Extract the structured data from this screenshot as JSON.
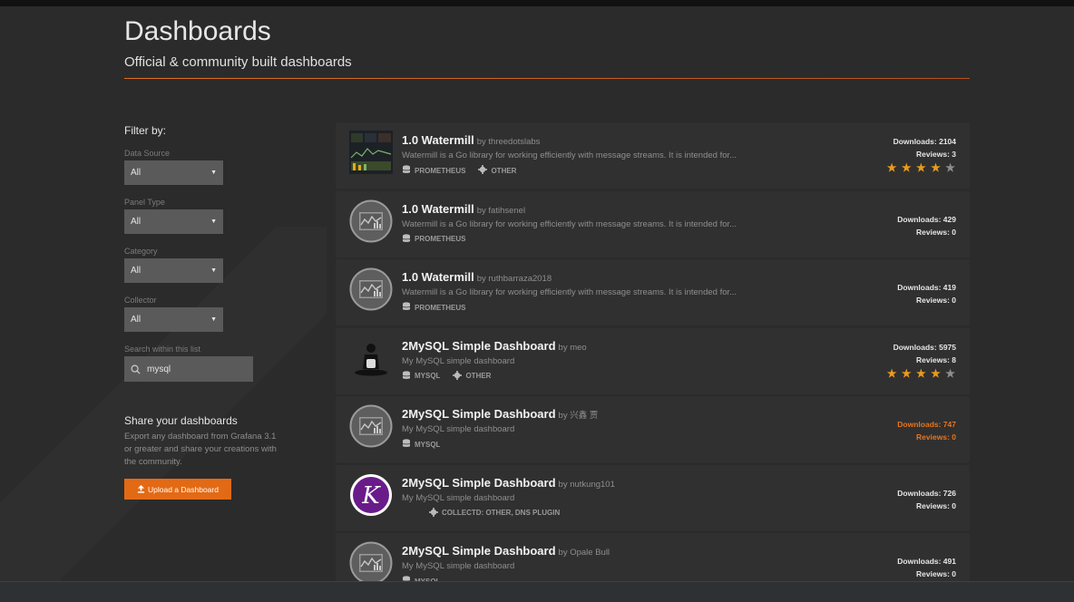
{
  "header": {
    "title": "Dashboards",
    "subtitle": "Official & community built dashboards"
  },
  "sidebar": {
    "filter_title": "Filter by:",
    "filters": [
      {
        "label": "Data Source",
        "value": "All"
      },
      {
        "label": "Panel Type",
        "value": "All"
      },
      {
        "label": "Category",
        "value": "All"
      },
      {
        "label": "Collector",
        "value": "All"
      }
    ],
    "search": {
      "label": "Search within this list",
      "value": "mysql"
    },
    "share": {
      "title": "Share your dashboards",
      "text": "Export any dashboard from Grafana 3.1 or greater and share your creations with the community.",
      "button_label": "Upload a Dashboard"
    }
  },
  "dashboards": [
    {
      "title": "1.0 Watermill",
      "author": "by threedotslabs",
      "description": "Watermill is a Go library for working efficiently with message streams. It is intended for...",
      "tags": [
        {
          "icon": "database-icon",
          "label": "PROMETHEUS"
        },
        {
          "icon": "gear-icon",
          "label": "OTHER"
        }
      ],
      "downloads": "Downloads: 2104",
      "reviews": "Reviews: 3",
      "rating": 4,
      "thumb": "screenshot"
    },
    {
      "title": "1.0 Watermill",
      "author": "by fatihsenel",
      "description": "Watermill is a Go library for working efficiently with message streams. It is intended for...",
      "tags": [
        {
          "icon": "database-icon",
          "label": "PROMETHEUS"
        }
      ],
      "downloads": "Downloads: 429",
      "reviews": "Reviews: 0",
      "rating": null,
      "thumb": "grafana"
    },
    {
      "title": "1.0 Watermill",
      "author": "by ruthbarraza2018",
      "description": "Watermill is a Go library for working efficiently with message streams. It is intended for...",
      "tags": [
        {
          "icon": "database-icon",
          "label": "PROMETHEUS"
        }
      ],
      "downloads": "Downloads: 419",
      "reviews": "Reviews: 0",
      "rating": null,
      "thumb": "grafana"
    },
    {
      "title": "2MySQL Simple Dashboard",
      "author": "by meo",
      "description": "My MySQL simple dashboard",
      "tags": [
        {
          "icon": "database-icon",
          "label": "MYSQL"
        },
        {
          "icon": "gear-icon",
          "label": "OTHER"
        }
      ],
      "downloads": "Downloads: 5975",
      "reviews": "Reviews: 8",
      "rating": 4,
      "thumb": "silhouette"
    },
    {
      "title": "2MySQL Simple Dashboard",
      "author": "by 兴鑫 贾",
      "description": "My MySQL simple dashboard",
      "tags": [
        {
          "icon": "database-icon",
          "label": "MYSQL"
        }
      ],
      "downloads": "Downloads: 747",
      "reviews": "Reviews: 0",
      "rating": null,
      "thumb": "grafana",
      "highlight": true
    },
    {
      "title": "2MySQL Simple Dashboard",
      "author": "by nutkung101",
      "description": "My MySQL simple dashboard",
      "tags": [
        {
          "icon": "gear-icon",
          "label": "COLLECTD: OTHER, DNS PLUGIN"
        }
      ],
      "downloads": "Downloads: 726",
      "reviews": "Reviews: 0",
      "rating": null,
      "thumb": "k-logo"
    },
    {
      "title": "2MySQL Simple Dashboard",
      "author": "by Opale Bull",
      "description": "My MySQL simple dashboard",
      "tags": [
        {
          "icon": "database-icon",
          "label": "MYSQL"
        }
      ],
      "downloads": "Downloads: 491",
      "reviews": "Reviews: 0",
      "rating": null,
      "thumb": "grafana"
    }
  ],
  "colors": {
    "accent": "#e36a14",
    "star": "#eb9b1b",
    "background": "#2b2b2b",
    "card": "#303030"
  }
}
